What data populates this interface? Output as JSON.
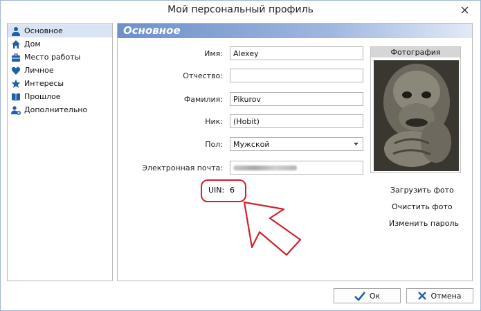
{
  "window": {
    "title": "Мой персональный профиль"
  },
  "sidebar": {
    "items": [
      {
        "label": "Основное",
        "icon": "user-icon",
        "active": true
      },
      {
        "label": "Дом",
        "icon": "home-icon",
        "active": false
      },
      {
        "label": "Место работы",
        "icon": "briefcase-icon",
        "active": false
      },
      {
        "label": "Личное",
        "icon": "heart-icon",
        "active": false
      },
      {
        "label": "Интересы",
        "icon": "star-icon",
        "active": false
      },
      {
        "label": "Прошлое",
        "icon": "book-icon",
        "active": false
      },
      {
        "label": "Дополнительно",
        "icon": "user-plus-icon",
        "active": false
      }
    ]
  },
  "section": {
    "title": "Основное"
  },
  "form": {
    "first_name": {
      "label": "Имя:",
      "value": "Alexey"
    },
    "middle_name": {
      "label": "Отчество:",
      "value": ""
    },
    "last_name": {
      "label": "Фамилия:",
      "value": "Pikurov"
    },
    "nick": {
      "label": "Ник:",
      "value": "(Hobit)"
    },
    "gender": {
      "label": "Пол:",
      "value": "Мужской"
    },
    "email": {
      "label": "Электронная почта:",
      "value": ""
    },
    "uin": {
      "label": "UIN:",
      "value": "6"
    }
  },
  "photo": {
    "title": "Фотография",
    "upload_label": "Загрузить фото",
    "clear_label": "Очистить фото",
    "change_password_label": "Изменить пароль"
  },
  "buttons": {
    "ok": "Ок",
    "cancel": "Отмена"
  },
  "colors": {
    "accent": "#6e8fc9",
    "highlight": "#d0202a",
    "icon_blue": "#1f5fa8"
  }
}
